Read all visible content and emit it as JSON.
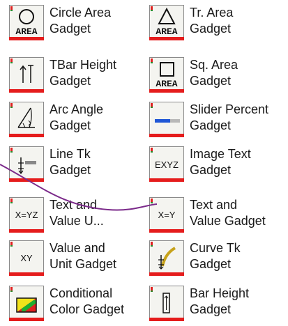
{
  "gadgets": [
    {
      "id": "circle-area",
      "line1": "Circle Area",
      "line2": "Gadget",
      "icon": "circle-area-icon",
      "icon_text": "AREA"
    },
    {
      "id": "tr-area",
      "line1": "Tr. Area",
      "line2": "Gadget",
      "icon": "triangle-area-icon",
      "icon_text": "AREA"
    },
    {
      "id": "tbar-height",
      "line1": "TBar Height",
      "line2": "Gadget",
      "icon": "tbar-height-icon",
      "icon_text": ""
    },
    {
      "id": "sq-area",
      "line1": "Sq. Area",
      "line2": "Gadget",
      "icon": "square-area-icon",
      "icon_text": "AREA"
    },
    {
      "id": "arc-angle",
      "line1": "Arc Angle",
      "line2": "Gadget",
      "icon": "arc-angle-icon",
      "icon_text": ""
    },
    {
      "id": "slider-percent",
      "line1": "Slider Percent",
      "line2": "Gadget",
      "icon": "slider-percent-icon",
      "icon_text": ""
    },
    {
      "id": "line-tk",
      "line1": "Line Tk",
      "line2": "Gadget",
      "icon": "line-tk-icon",
      "icon_text": ""
    },
    {
      "id": "image-text",
      "line1": "Image Text",
      "line2": "Gadget",
      "icon": "image-text-icon",
      "icon_text": "EXYZ"
    },
    {
      "id": "text-value-u",
      "line1": "Text and",
      "line2": "Value U...",
      "icon": "text-value-unit-icon",
      "icon_text": "X=YZ"
    },
    {
      "id": "text-value",
      "line1": "Text and",
      "line2": "Value Gadget",
      "icon": "text-value-icon",
      "icon_text": "X=Y"
    },
    {
      "id": "value-unit",
      "line1": "Value and",
      "line2": "Unit Gadget",
      "icon": "value-unit-icon",
      "icon_text": "XY"
    },
    {
      "id": "curve-tk",
      "line1": "Curve Tk",
      "line2": "Gadget",
      "icon": "curve-tk-icon",
      "icon_text": ""
    },
    {
      "id": "conditional-color",
      "line1": "Conditional",
      "line2": "Color Gadget",
      "icon": "conditional-color-icon",
      "icon_text": ""
    },
    {
      "id": "bar-height",
      "line1": "Bar Height",
      "line2": "Gadget",
      "icon": "bar-height-icon",
      "icon_text": ""
    }
  ],
  "colors": {
    "flag": "#e02020",
    "bar": "#e51c1c",
    "connector": "#7b2a8a",
    "slider_fill": "#1f56d6",
    "slider_track": "#b8b8b8",
    "cc_yellow": "#f2e21a",
    "cc_green": "#1fae2f",
    "cc_red": "#e02020"
  }
}
